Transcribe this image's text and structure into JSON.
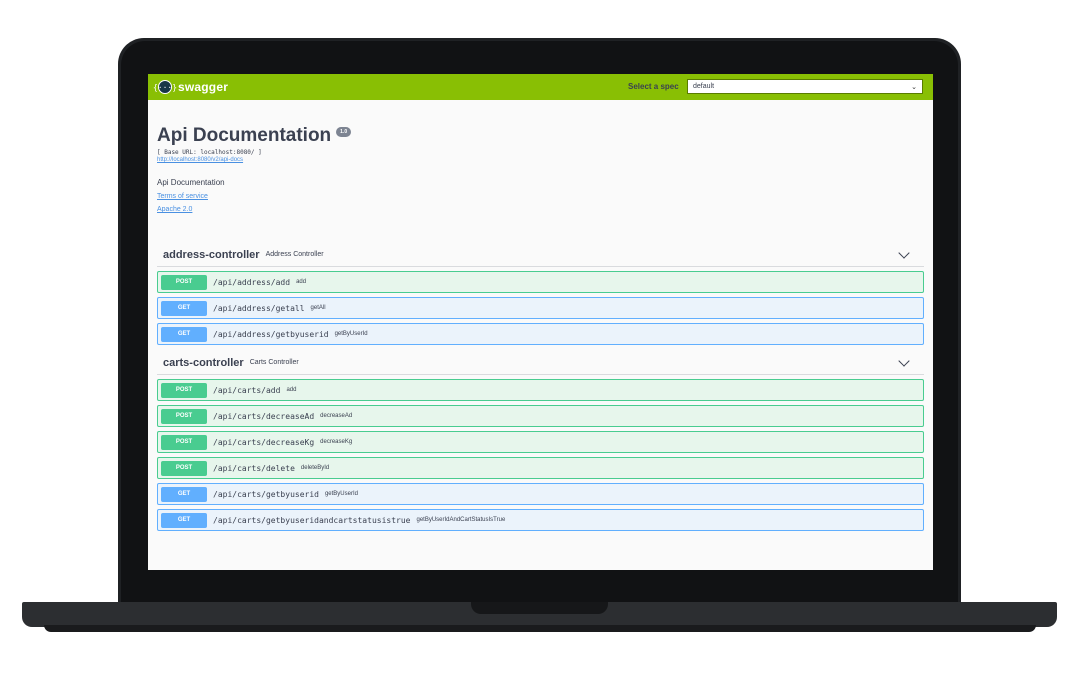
{
  "topbar": {
    "logo_symbol": "{···}",
    "logo_text": "swagger",
    "select_label": "Select a spec",
    "select_value": "default",
    "select_chevron": "⌄",
    "colors": {
      "background": "#89bf04"
    }
  },
  "info": {
    "title": "Api Documentation",
    "version": "1.0",
    "base_url": "[ Base URL: localhost:8080/ ]",
    "docs_url": "http://localhost:8080/v2/api-docs",
    "description": "Api Documentation",
    "terms_of_service": "Terms of service",
    "license": "Apache 2.0"
  },
  "tags": [
    {
      "name": "address-controller",
      "description": "Address Controller",
      "operations": [
        {
          "method": "POST",
          "path": "/api/address/add",
          "summary": "add"
        },
        {
          "method": "GET",
          "path": "/api/address/getall",
          "summary": "getAll"
        },
        {
          "method": "GET",
          "path": "/api/address/getbyuserid",
          "summary": "getByUserId"
        }
      ]
    },
    {
      "name": "carts-controller",
      "description": "Carts Controller",
      "operations": [
        {
          "method": "POST",
          "path": "/api/carts/add",
          "summary": "add"
        },
        {
          "method": "POST",
          "path": "/api/carts/decreaseAd",
          "summary": "decreaseAd"
        },
        {
          "method": "POST",
          "path": "/api/carts/decreaseKg",
          "summary": "decreaseKg"
        },
        {
          "method": "POST",
          "path": "/api/carts/delete",
          "summary": "deleteById"
        },
        {
          "method": "GET",
          "path": "/api/carts/getbyuserid",
          "summary": "getByUserId"
        },
        {
          "method": "GET",
          "path": "/api/carts/getbyuseridandcartstatusistrue",
          "summary": "getByUserIdAndCartStatusIsTrue"
        }
      ]
    }
  ],
  "colors": {
    "post": "#49cc90",
    "get": "#61affe",
    "link": "#4990e2",
    "text": "#3b4151"
  }
}
